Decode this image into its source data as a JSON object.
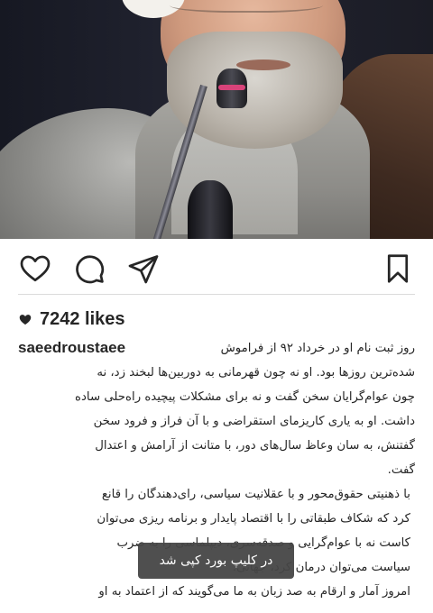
{
  "post": {
    "likes": "7242 likes",
    "username": "saeedroustaee",
    "caption_lines": [
      "روز ثبت نام او در خرداد ۹۲ از فراموش",
      "شده‌ترین روزها بود. او نه چون قهرمانی به دوربین‌ها لبخند زد، نه",
      "چون عوام‌گرایان سخن گفت و نه برای مشکلات پیچیده راه‌حلی ساده",
      "داشت. او به یاری کاریزمای استقراضی و با آن فراز و فرود سخن",
      "گفتنش، به سان وعاظ سال‌های دور، با متانت از آرامش و اعتدال",
      "گفت.",
      "با ذهنیتی حقوق‌محور و با عقلانیت سیاسی، رای‌دهندگان را قانع",
      "کرد که شکاف طبقاتی را با اقتصاد پایدار و برنامه ریزی می‌توان",
      "کاست نه با عوام‌گرایی و صدقه‌سری، دیپلماسی را به ضرب",
      "سیاست می‌توان درمان کرد، جهانی.",
      "امروز آمار و ارقام به صد زبان به ما می‌گویند که از اعتماد به او"
    ]
  },
  "toast": {
    "text": "در کلیپ بورد کپی شد"
  },
  "icons": {
    "like": "heart-outline-icon",
    "comment": "comment-bubble-icon",
    "share": "paper-plane-icon",
    "save": "bookmark-icon",
    "likes_marker": "heart-filled-icon"
  }
}
